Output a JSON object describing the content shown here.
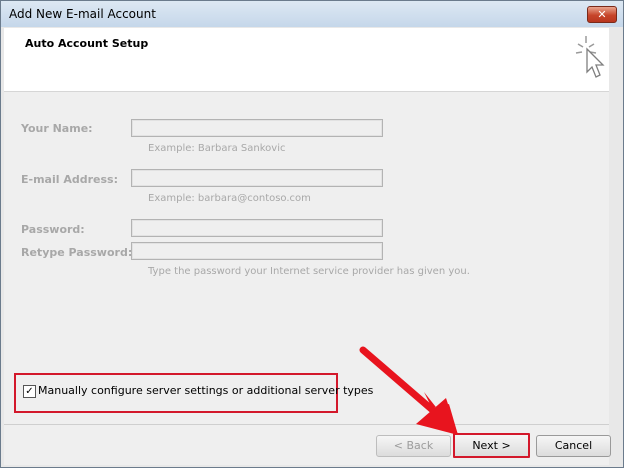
{
  "window": {
    "title": "Add New E-mail Account",
    "close_glyph": "✕"
  },
  "header": {
    "title": "Auto Account Setup",
    "icon": "wizard-cursor-icon"
  },
  "form": {
    "name_label": "Your Name:",
    "name_value": "",
    "name_hint": "Example: Barbara Sankovic",
    "email_label": "E-mail Address:",
    "email_value": "",
    "email_hint": "Example: barbara@contoso.com",
    "password_label": "Password:",
    "password_value": "",
    "retype_label": "Retype Password:",
    "retype_value": "",
    "password_hint": "Type the password your Internet service provider has given you."
  },
  "manual": {
    "checked": true,
    "check_glyph": "✓",
    "label": "Manually configure server settings or additional server types"
  },
  "buttons": {
    "back": "< Back",
    "next": "Next >",
    "cancel": "Cancel"
  },
  "colors": {
    "highlight": "#d3182b",
    "arrow": "#e8141e",
    "disabled_text": "#a8a8a8"
  }
}
